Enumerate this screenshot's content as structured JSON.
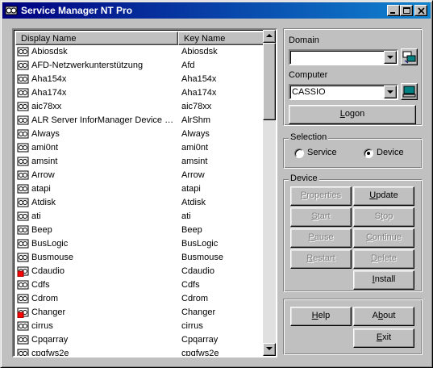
{
  "window": {
    "title": "Service Manager NT Pro"
  },
  "list": {
    "col_display": "Display Name",
    "col_key": "Key Name",
    "rows": [
      {
        "display": "Abiosdsk",
        "key": "Abiosdsk",
        "icon": "device-icon"
      },
      {
        "display": "AFD-Netzwerkunterstützung",
        "key": "Afd",
        "icon": "device-icon"
      },
      {
        "display": "Aha154x",
        "key": "Aha154x",
        "icon": "device-icon"
      },
      {
        "display": "Aha174x",
        "key": "Aha174x",
        "icon": "device-icon"
      },
      {
        "display": "aic78xx",
        "key": "aic78xx",
        "icon": "device-icon"
      },
      {
        "display": "ALR Server InforManager Device D...",
        "key": "AlrShm",
        "icon": "device-icon"
      },
      {
        "display": "Always",
        "key": "Always",
        "icon": "device-icon"
      },
      {
        "display": "ami0nt",
        "key": "ami0nt",
        "icon": "device-icon"
      },
      {
        "display": "amsint",
        "key": "amsint",
        "icon": "device-icon"
      },
      {
        "display": "Arrow",
        "key": "Arrow",
        "icon": "device-icon"
      },
      {
        "display": "atapi",
        "key": "atapi",
        "icon": "device-icon"
      },
      {
        "display": "Atdisk",
        "key": "Atdisk",
        "icon": "device-icon"
      },
      {
        "display": "ati",
        "key": "ati",
        "icon": "device-icon"
      },
      {
        "display": "Beep",
        "key": "Beep",
        "icon": "device-icon"
      },
      {
        "display": "BusLogic",
        "key": "BusLogic",
        "icon": "device-icon"
      },
      {
        "display": "Busmouse",
        "key": "Busmouse",
        "icon": "device-icon"
      },
      {
        "display": "Cdaudio",
        "key": "Cdaudio",
        "icon": "device-stopped-icon"
      },
      {
        "display": "Cdfs",
        "key": "Cdfs",
        "icon": "device-icon"
      },
      {
        "display": "Cdrom",
        "key": "Cdrom",
        "icon": "device-icon"
      },
      {
        "display": "Changer",
        "key": "Changer",
        "icon": "device-stopped-icon"
      },
      {
        "display": "cirrus",
        "key": "cirrus",
        "icon": "device-icon"
      },
      {
        "display": "Cpqarray",
        "key": "Cpqarray",
        "icon": "device-icon"
      },
      {
        "display": "cpqfws2e",
        "key": "cpqfws2e",
        "icon": "device-icon"
      }
    ]
  },
  "domain": {
    "label": "Domain",
    "value": ""
  },
  "computer": {
    "label": "Computer",
    "value": "CASSIO",
    "logon_label": "Logon"
  },
  "selection": {
    "label": "Selection",
    "service_label": "Service",
    "device_label": "Device",
    "selected": "Device"
  },
  "device": {
    "label": "Device",
    "properties": "Properties",
    "update": "Update",
    "start": "Start",
    "stop": "Stop",
    "pause": "Pause",
    "continue": "Continue",
    "restart": "Restart",
    "delete": "Delete",
    "install": "Install"
  },
  "bottom": {
    "help": "Help",
    "about": "About",
    "exit": "Exit"
  },
  "colors": {
    "title_start": "#000080",
    "title_end": "#1084d0",
    "face": "#c0c0c0",
    "stopped_marker": "#ff0000"
  }
}
